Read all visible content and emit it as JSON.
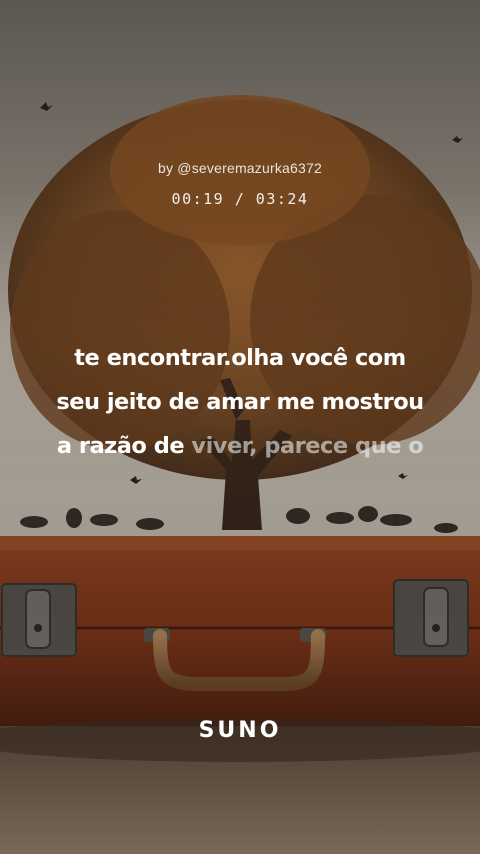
{
  "byline": "by @severemazurka6372",
  "time": {
    "current": "00:19",
    "separator": " / ",
    "total": "03:24"
  },
  "lyrics": {
    "line1": "te encontrar.olha você com",
    "line2": "seu jeito de amar me mostrou",
    "line3_sung": "a razão de ",
    "line3_unsung": "viver, parece que o"
  },
  "logo": "SUNO",
  "colors": {
    "sky": "#cfc7bb",
    "tree_foliage": "#7a4a22",
    "suitcase": "#8a3f1f",
    "ground": "#7c6a58"
  }
}
